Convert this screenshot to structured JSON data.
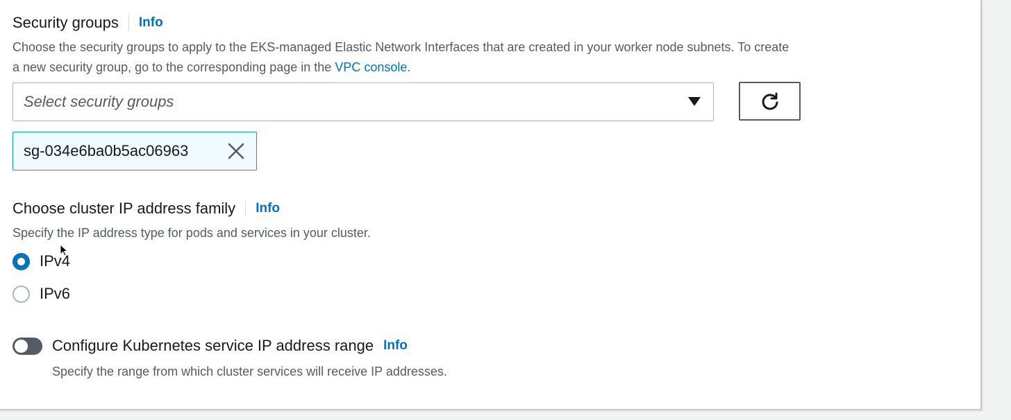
{
  "security_groups": {
    "label": "Security groups",
    "info": "Info",
    "description_1": "Choose the security groups to apply to the EKS-managed Elastic Network Interfaces that are created in your worker node subnets. To create",
    "description_2": "a new security group, go to the corresponding page in the",
    "link": "VPC console",
    "description_end": ".",
    "select_placeholder": "Select security groups",
    "select_icon": "caret-down-icon",
    "refresh_icon": "refresh-icon",
    "selected_tokens": [
      "sg-034e6ba0b5ac06963"
    ],
    "remove_icon": "close-icon"
  },
  "ip_family": {
    "label": "Choose cluster IP address family",
    "info": "Info",
    "description": "Specify the IP address type for pods and services in your cluster.",
    "options": [
      {
        "label": "IPv4",
        "selected": true
      },
      {
        "label": "IPv6",
        "selected": false
      }
    ]
  },
  "service_range": {
    "label": "Configure Kubernetes service IP address range",
    "info": "Info",
    "description": "Specify the range from which cluster services will receive IP addresses.",
    "toggle_on": false
  },
  "colors": {
    "link": "#0073bb",
    "token_border": "#00a1c9",
    "token_bg": "#f1faff",
    "toggle_off": "#545b64"
  }
}
